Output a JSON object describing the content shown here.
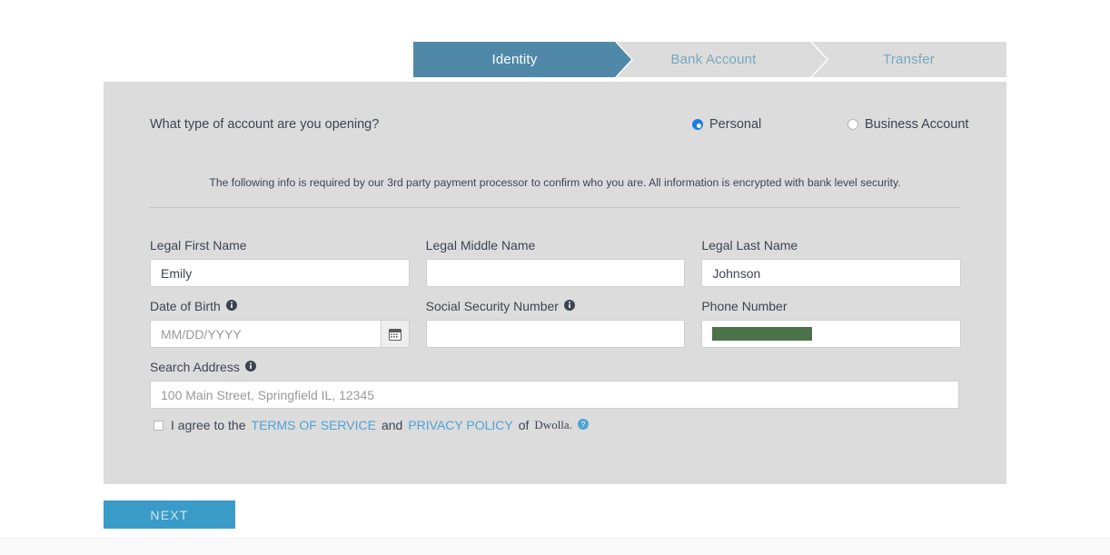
{
  "stepper": {
    "steps": [
      {
        "label": "Identity",
        "state": "active"
      },
      {
        "label": "Bank Account",
        "state": "inactive"
      },
      {
        "label": "Transfer",
        "state": "inactive"
      }
    ]
  },
  "form": {
    "account_type_question": "What type of account are you opening?",
    "account_type_options": [
      {
        "label": "Personal",
        "selected": true
      },
      {
        "label": "Business Account",
        "selected": false
      }
    ],
    "note": "The following info is required by our 3rd party payment processor to confirm who you are. All information is encrypted with bank level security.",
    "fields": {
      "first_name": {
        "label": "Legal First Name",
        "value": "Emily",
        "placeholder": ""
      },
      "middle_name": {
        "label": "Legal Middle Name",
        "value": "",
        "placeholder": ""
      },
      "last_name": {
        "label": "Legal Last Name",
        "value": "Johnson",
        "placeholder": ""
      },
      "date_of_birth": {
        "label": "Date of Birth",
        "value": "",
        "placeholder": "MM/DD/YYYY",
        "has_info": true
      },
      "ssn": {
        "label": "Social Security Number",
        "value": "",
        "placeholder": "",
        "has_info": true
      },
      "phone": {
        "label": "Phone Number",
        "value": "",
        "placeholder": "",
        "redacted": true
      },
      "search_address": {
        "label": "Search Address",
        "value": "",
        "placeholder": "100 Main Street, Springfield IL, 12345",
        "has_info": true
      }
    },
    "agreement": {
      "prefix": "I agree to the",
      "terms_link": "TERMS OF SERVICE",
      "conjunction": "and",
      "privacy_link": "PRIVACY POLICY",
      "suffix": "of",
      "provider": "Dwolla.",
      "checked": false
    }
  },
  "actions": {
    "next_label": "NEXT"
  },
  "colors": {
    "active_step": "#5089a8",
    "inactive_step": "#dcdcdc",
    "inactive_step_text": "#77a8bf",
    "panel_bg": "#dcdcdc",
    "next_button": "#3a9bc9",
    "link": "#4ea3d4",
    "radio_selected": "#1a7fe0",
    "redaction": "#4b7249"
  }
}
